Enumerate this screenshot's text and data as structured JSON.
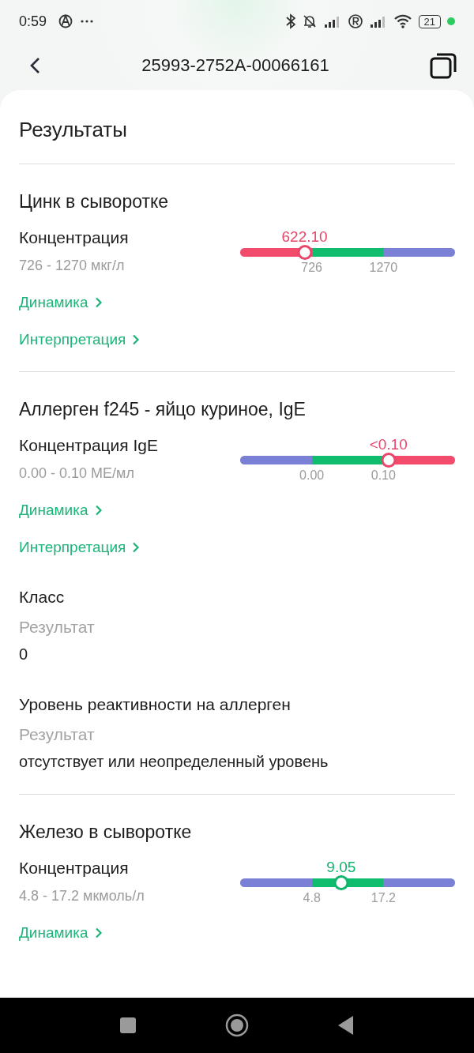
{
  "status_bar": {
    "time": "0:59",
    "battery": "21"
  },
  "header": {
    "title": "25993-2752A-00066161"
  },
  "page_title": "Результаты",
  "sections": [
    {
      "title": "Цинк в сыворотке",
      "items": [
        {
          "kind": "measure",
          "label": "Концентрация",
          "range": "726 - 1270 мкг/л",
          "value": "622.10",
          "out_of_range": true,
          "level": 0.3,
          "segments": [
            {
              "color": "#f24b6b"
            },
            {
              "color": "#10bd6f"
            },
            {
              "color": "#7a80d6"
            }
          ],
          "ticks": [
            "726",
            "1270"
          ],
          "links": [
            "Динамика",
            "Интерпретация"
          ]
        }
      ]
    },
    {
      "title": "Аллерген f245 - яйцо куриное, IgE",
      "items": [
        {
          "kind": "measure",
          "label": "Концентрация IgE",
          "range": "0.00 - 0.10 МЕ/мл",
          "value": "<0.10",
          "out_of_range": true,
          "level": 0.69,
          "segments": [
            {
              "color": "#7a80d6"
            },
            {
              "color": "#10bd6f"
            },
            {
              "color": "#f24b6b"
            }
          ],
          "ticks": [
            "0.00",
            "0.10"
          ],
          "links": [
            "Динамика",
            "Интерпретация"
          ]
        },
        {
          "kind": "result",
          "label": "Класс",
          "caption": "Результат",
          "value": "0"
        },
        {
          "kind": "result",
          "label": "Уровень реактивности на аллерген",
          "caption": "Результат",
          "value": "отсутствует или неопределенный уровень"
        }
      ]
    },
    {
      "title": "Железо в сыворотке",
      "items": [
        {
          "kind": "measure",
          "label": "Концентрация",
          "range": "4.8 - 17.2 мкмоль/л",
          "value": "9.05",
          "out_of_range": false,
          "level": 0.47,
          "segments": [
            {
              "color": "#7a80d6"
            },
            {
              "color": "#10bd6f"
            },
            {
              "color": "#7a80d6"
            }
          ],
          "ticks": [
            "4.8",
            "17.2"
          ],
          "links": [
            "Динамика"
          ]
        }
      ]
    }
  ]
}
